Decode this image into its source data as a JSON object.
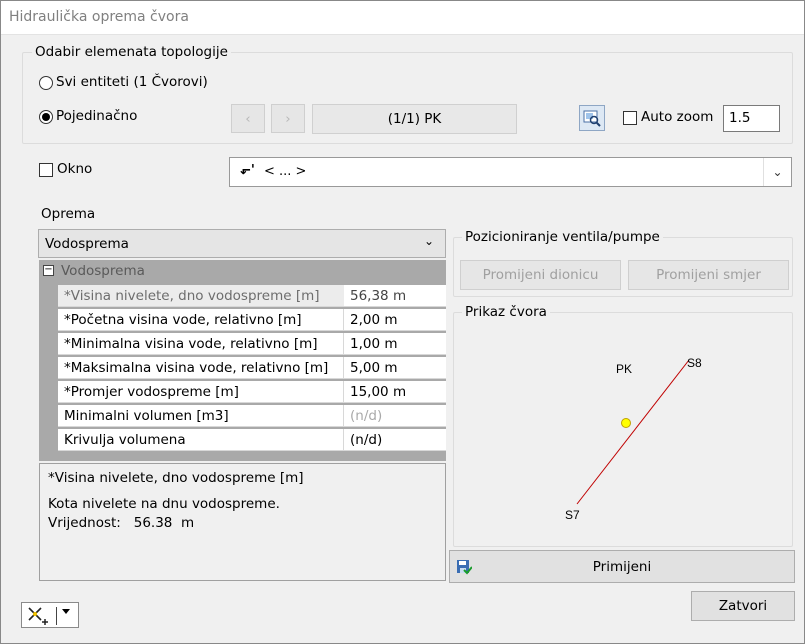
{
  "window": {
    "title": "Hidraulička oprema čvora"
  },
  "topology": {
    "legend": "Odabir elemenata topologije",
    "radio_all": "Svi entiteti (1 Čvorovi)",
    "radio_single": "Pojedinačno",
    "prev_symbol": "‹",
    "next_symbol": "›",
    "current": "(1/1)  PK",
    "auto_zoom_label": "Auto zoom",
    "auto_zoom_value": "1.5"
  },
  "okno": {
    "label": "Okno",
    "select_value": "< ... >"
  },
  "oprema": {
    "label": "Oprema",
    "select_value": "Vodosprema",
    "category": "Vodosprema",
    "properties": [
      {
        "name": "*Visina nivelete, dno vodospreme [m]",
        "value": "56,38 m"
      },
      {
        "name": "*Početna visina vode, relativno [m]",
        "value": "2,00 m"
      },
      {
        "name": "*Minimalna visina vode, relativno [m]",
        "value": "1,00 m"
      },
      {
        "name": "*Maksimalna visina vode, relativno [m]",
        "value": "5,00 m"
      },
      {
        "name": "*Promjer vodospreme [m]",
        "value": "15,00 m"
      },
      {
        "name": "Minimalni volumen [m3]",
        "value": "(n/d)"
      },
      {
        "name": "Krivulja volumena",
        "value": "(n/d)"
      }
    ],
    "description": {
      "title": "*Visina nivelete, dno vodospreme [m]",
      "text": "Kota nivelete na dnu vodospreme.",
      "value_line": "Vrijednost:   56.38  m"
    }
  },
  "positioning": {
    "legend": "Pozicioniranje ventila/pumpe",
    "change_section": "Promijeni dionicu",
    "change_direction": "Promijeni smjer"
  },
  "preview": {
    "legend": "Prikaz čvora",
    "node_label": "PK",
    "start_label": "S8",
    "end_label": "S7",
    "line_color": "#c00000",
    "node_color": "#ffff00"
  },
  "actions": {
    "apply": "Primijeni",
    "close": "Zatvori"
  },
  "icons": {
    "zoom": "zoom-select-icon",
    "save": "save-check-icon",
    "tool": "add-element-icon",
    "okno_symbol": "pipe-node-icon"
  }
}
